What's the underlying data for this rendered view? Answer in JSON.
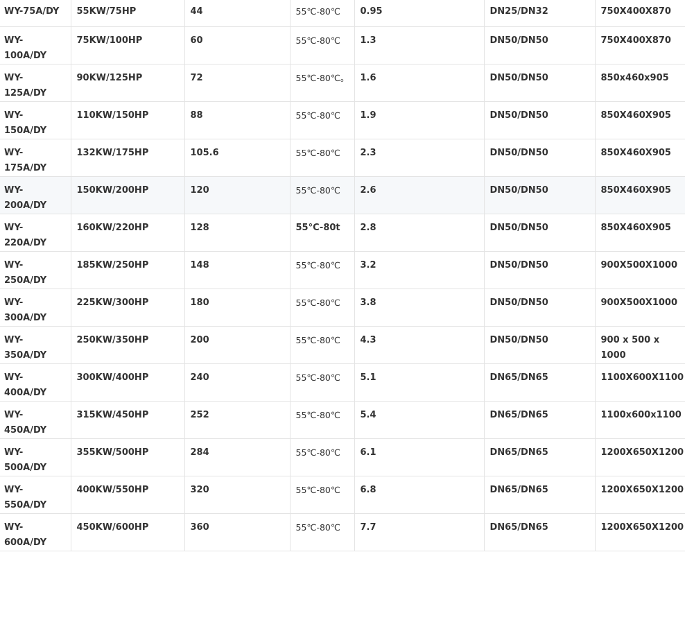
{
  "table": {
    "rows": [
      {
        "model": "WY-75A/DY",
        "power": "55KW/75HP",
        "value": "44",
        "temperature": "55℃-80℃",
        "rate": "0.95",
        "pipe": "DN25/DN32",
        "dimensions": "750X400X870"
      },
      {
        "model": "WY-100A/DY",
        "power": "75KW/100HP",
        "value": "60",
        "temperature": "55℃-80℃",
        "rate": "1.3",
        "pipe": "DN50/DN50",
        "dimensions": "750X400X870"
      },
      {
        "model": "WY-125A/DY",
        "power": "90KW/125HP",
        "value": "72",
        "temperature": "55℃-80℃。",
        "rate": "1.6",
        "pipe": "DN50/DN50",
        "dimensions": "850x460x905"
      },
      {
        "model": "WY-150A/DY",
        "power": "110KW/150HP",
        "value": "88",
        "temperature": "55℃-80℃",
        "rate": "1.9",
        "pipe": "DN50/DN50",
        "dimensions": "850X460X905"
      },
      {
        "model": "WY-175A/DY",
        "power": "132KW/175HP",
        "value": "105.6",
        "temperature": "55℃-80℃",
        "rate": "2.3",
        "pipe": "DN50/DN50",
        "dimensions": "850X460X905"
      },
      {
        "model": "WY-200A/DY",
        "power": "150KW/200HP",
        "value": "120",
        "temperature": "55℃-80℃",
        "rate": "2.6",
        "pipe": "DN50/DN50",
        "dimensions": "850X460X905"
      },
      {
        "model": "WY-220A/DY",
        "power": "160KW/220HP",
        "value": "128",
        "temperature": "55°C-80t",
        "rate": "2.8",
        "pipe": "DN50/DN50",
        "dimensions": "850X460X905"
      },
      {
        "model": "WY-250A/DY",
        "power": "185KW/250HP",
        "value": "148",
        "temperature": "55℃-80℃",
        "rate": "3.2",
        "pipe": "DN50/DN50",
        "dimensions": "900X500X1000"
      },
      {
        "model": "WY-300A/DY",
        "power": "225KW/300HP",
        "value": "180",
        "temperature": "55℃-80℃",
        "rate": "3.8",
        "pipe": "DN50/DN50",
        "dimensions": "900X500X1000"
      },
      {
        "model": "WY-350A/DY",
        "power": "250KW/350HP",
        "value": "200",
        "temperature": "55℃-80℃",
        "rate": "4.3",
        "pipe": "DN50/DN50",
        "dimensions": "900 x 500 x 1000"
      },
      {
        "model": "WY-400A/DY",
        "power": "300KW/400HP",
        "value": "240",
        "temperature": "55℃-80℃",
        "rate": "5.1",
        "pipe": "DN65/DN65",
        "dimensions": "1100X600X1100"
      },
      {
        "model": "WY-450A/DY",
        "power": "315KW/450HP",
        "value": "252",
        "temperature": "55℃-80℃",
        "rate": "5.4",
        "pipe": "DN65/DN65",
        "dimensions": "1100x600x1100"
      },
      {
        "model": "WY-500A/DY",
        "power": "355KW/500HP",
        "value": "284",
        "temperature": "55℃-80℃",
        "rate": "6.1",
        "pipe": "DN65/DN65",
        "dimensions": "1200X650X1200"
      },
      {
        "model": "WY-550A/DY",
        "power": "400KW/550HP",
        "value": "320",
        "temperature": "55℃-80℃",
        "rate": "6.8",
        "pipe": "DN65/DN65",
        "dimensions": "1200X650X1200"
      },
      {
        "model": "WY-600A/DY",
        "power": "450KW/600HP",
        "value": "360",
        "temperature": "55℃-80℃",
        "rate": "7.7",
        "pipe": "DN65/DN65",
        "dimensions": "1200X650X1200"
      }
    ]
  }
}
